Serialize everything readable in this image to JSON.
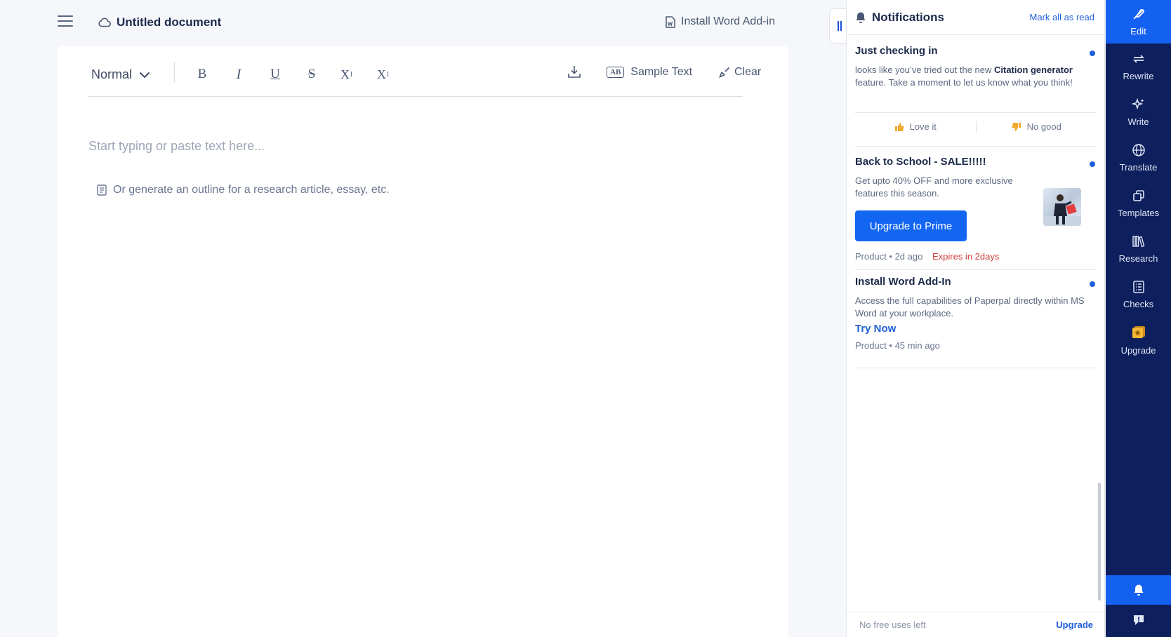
{
  "header": {
    "doc_title": "Untitled document",
    "install_addin": "Install Word Add-in"
  },
  "toolbar": {
    "style_value": "Normal",
    "bold": "B",
    "italic": "I",
    "underline": "U",
    "strike": "S",
    "superscript_base": "X",
    "superscript_mark": "1",
    "subscript_base": "X",
    "subscript_mark": "1",
    "sample_badge": "AB",
    "sample_text": "Sample Text",
    "clear": "Clear"
  },
  "editor": {
    "placeholder": "Start typing or paste text here...",
    "outline_link": "Or generate an outline for a research article, essay, etc."
  },
  "notifications": {
    "title": "Notifications",
    "mark_all": "Mark all as read",
    "items": [
      {
        "title": "Just checking in",
        "body_pre": "looks like you’ve tried out the new ",
        "body_bold": "Citation generator",
        "body_post": " feature. Take a moment to let us know what you think!",
        "love": "Love it",
        "no_good": "No good"
      },
      {
        "title": "Back to School - SALE!!!!!",
        "body": "Get upto 40% OFF and more exclusive features this season.",
        "cta": "Upgrade to Prime",
        "meta": "Product • 2d ago",
        "expires": "Expires in 2days"
      },
      {
        "title": "Install Word Add-In",
        "body": "Access the full capabilities of Paperpal directly within MS Word at your workplace.",
        "cta": "Try Now",
        "meta": "Product • 45 min ago"
      }
    ],
    "footer_left": "No free uses left",
    "footer_right": "Upgrade"
  },
  "rail": {
    "items": [
      {
        "label": "Edit"
      },
      {
        "label": "Rewrite"
      },
      {
        "label": "Write"
      },
      {
        "label": "Translate"
      },
      {
        "label": "Templates"
      },
      {
        "label": "Research"
      },
      {
        "label": "Checks"
      },
      {
        "label": "Upgrade"
      }
    ]
  },
  "colors": {
    "rail_bg": "#0d1f5c",
    "rail_active": "#1460f0",
    "accent": "#1366f2",
    "expires": "#d0413c"
  }
}
